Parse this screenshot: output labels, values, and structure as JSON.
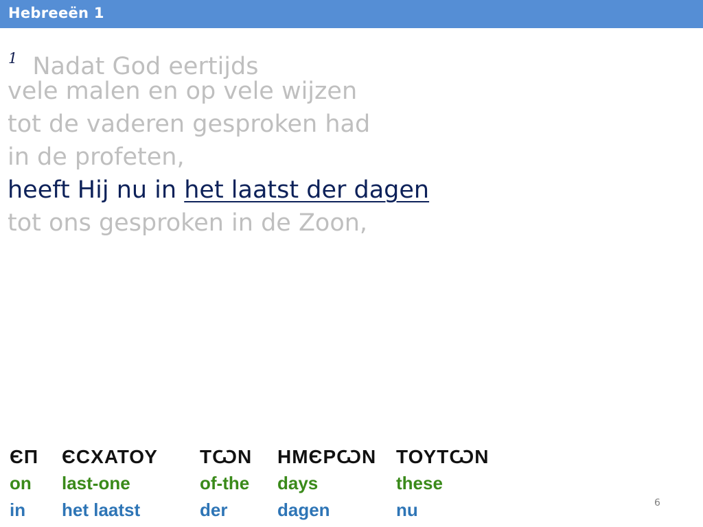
{
  "header": {
    "title": "Hebreeën 1"
  },
  "verse": {
    "number": "1",
    "lines": [
      "Nadat God eertijds",
      "vele malen en op vele wijzen",
      "tot de vaderen gesproken had",
      "in de profeten,"
    ],
    "highlight_prefix": "heeft Hij nu in ",
    "highlight_underlined": "het laatst der dagen",
    "last_line": "tot ons gesproken in de Zoon,"
  },
  "interlinear": {
    "greek": [
      "ЄΠ",
      "ЄСΧΑΤΟΥ",
      "ΤѠΝ",
      "ΗΜЄΡѠΝ",
      "ΤΟΥΤѠΝ"
    ],
    "english": [
      "on",
      "last-one",
      "of-the",
      "days",
      "these"
    ],
    "dutch": [
      "in",
      "het laatst",
      "der",
      "dagen",
      "nu"
    ]
  },
  "colors": {
    "header_bg": "#558ed5",
    "faded_text": "#bfbfbf",
    "highlight_text": "#0d2159",
    "english_green": "#3a8a1a",
    "dutch_blue": "#2e75b6"
  },
  "footer": {
    "page_number": "6"
  }
}
